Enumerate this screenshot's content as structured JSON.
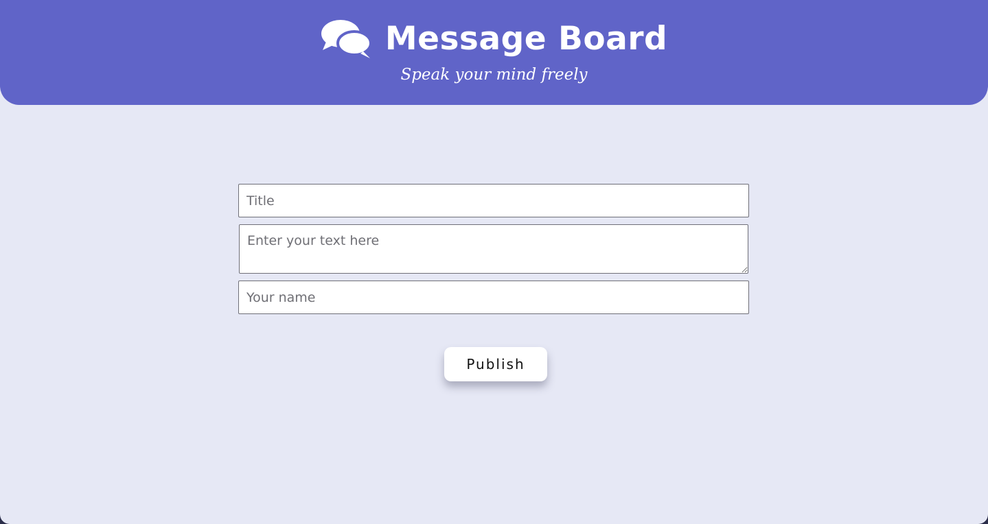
{
  "header": {
    "title": "Message Board",
    "subtitle": "Speak your mind freely",
    "icon": "comments-icon",
    "background_color": "#6064c8"
  },
  "form": {
    "title_placeholder": "Title",
    "title_value": "",
    "text_placeholder": "Enter your text here",
    "text_value": "",
    "name_placeholder": "Your name",
    "name_value": "",
    "publish_label": "Publish"
  },
  "colors": {
    "page_background": "#e6e8f5",
    "accent": "#6064c8",
    "button_background": "#ffffff"
  }
}
